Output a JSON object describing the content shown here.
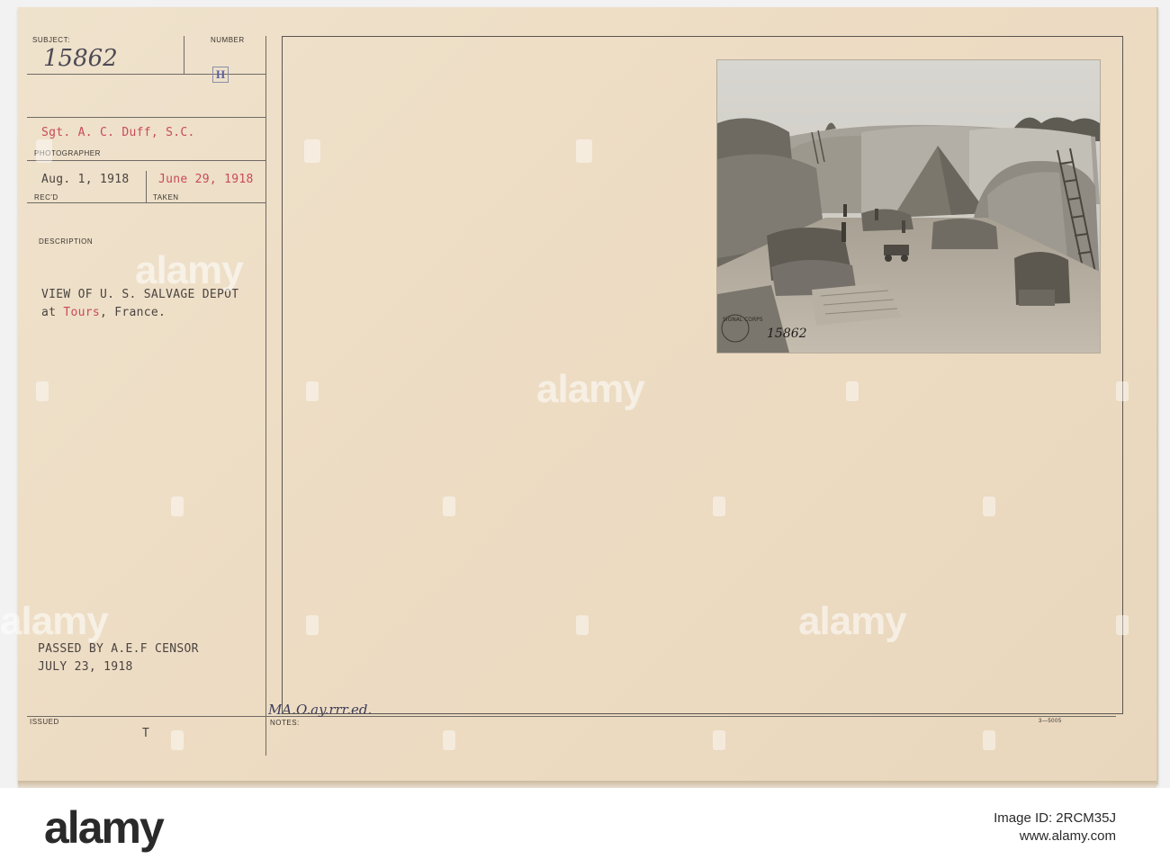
{
  "card": {
    "subject_label": "SUBJECT:",
    "subject_value": "15862",
    "number_label": "NUMBER",
    "number_value": "H",
    "photographer_name": "Sgt. A. C. Duff, S.C.",
    "photographer_label": "PHOTOGRAPHER",
    "recd_date": "Aug. 1, 1918",
    "recd_label": "REC'D",
    "taken_date": "June 29, 1918",
    "taken_label": "TAKEN",
    "description_label": "DESCRIPTION",
    "description_line1": "VIEW OF U. S. SALVAGE DEPOT",
    "description_line2_a": "at ",
    "description_line2_b": "Tours",
    "description_line2_c": ", France.",
    "censor_line1": "PASSED BY A.E.F CENSOR",
    "censor_line2": "JULY 23, 1918",
    "issued_label": "ISSUED",
    "issued_value": "T",
    "notes_label": "NOTES:",
    "notes_handwriting": "MA.O.ay.rrr.ed.",
    "form_number": "3—5005"
  },
  "photo": {
    "stamp_text": "SIGNAL CORPS",
    "handwritten_number": "15862"
  },
  "watermark": {
    "text": "alamy"
  },
  "footer": {
    "logo": "alamy",
    "image_id_label": "Image ID: 2RCM35J",
    "site": "www.alamy.com"
  },
  "colors": {
    "card_bg": "#eddcc3",
    "typed_red": "#c94a5a",
    "typed_dark": "#4a4440"
  }
}
